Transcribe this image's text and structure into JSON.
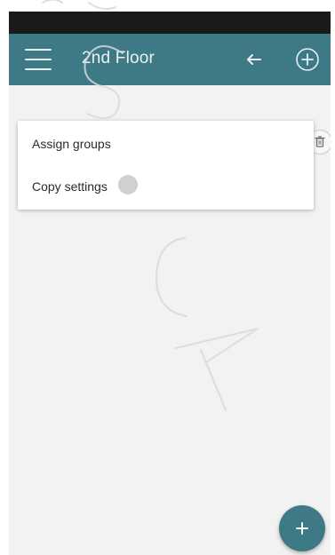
{
  "app_bar": {
    "title": "2nd Floor",
    "menu_icon": "hamburger-menu-icon",
    "back_icon": "arrow-left-icon",
    "add_icon": "plus-circle-icon",
    "background": "#3d7a86"
  },
  "context_menu": {
    "items": [
      {
        "label": "Assign groups"
      },
      {
        "label": "Copy settings"
      }
    ]
  },
  "content": {
    "row_action_icon": "trash-icon"
  },
  "fab": {
    "icon": "plus-icon",
    "color": "#3d7a86"
  },
  "colors": {
    "status_bar": "#1a1a1a",
    "content_background": "#f2f2f2"
  }
}
